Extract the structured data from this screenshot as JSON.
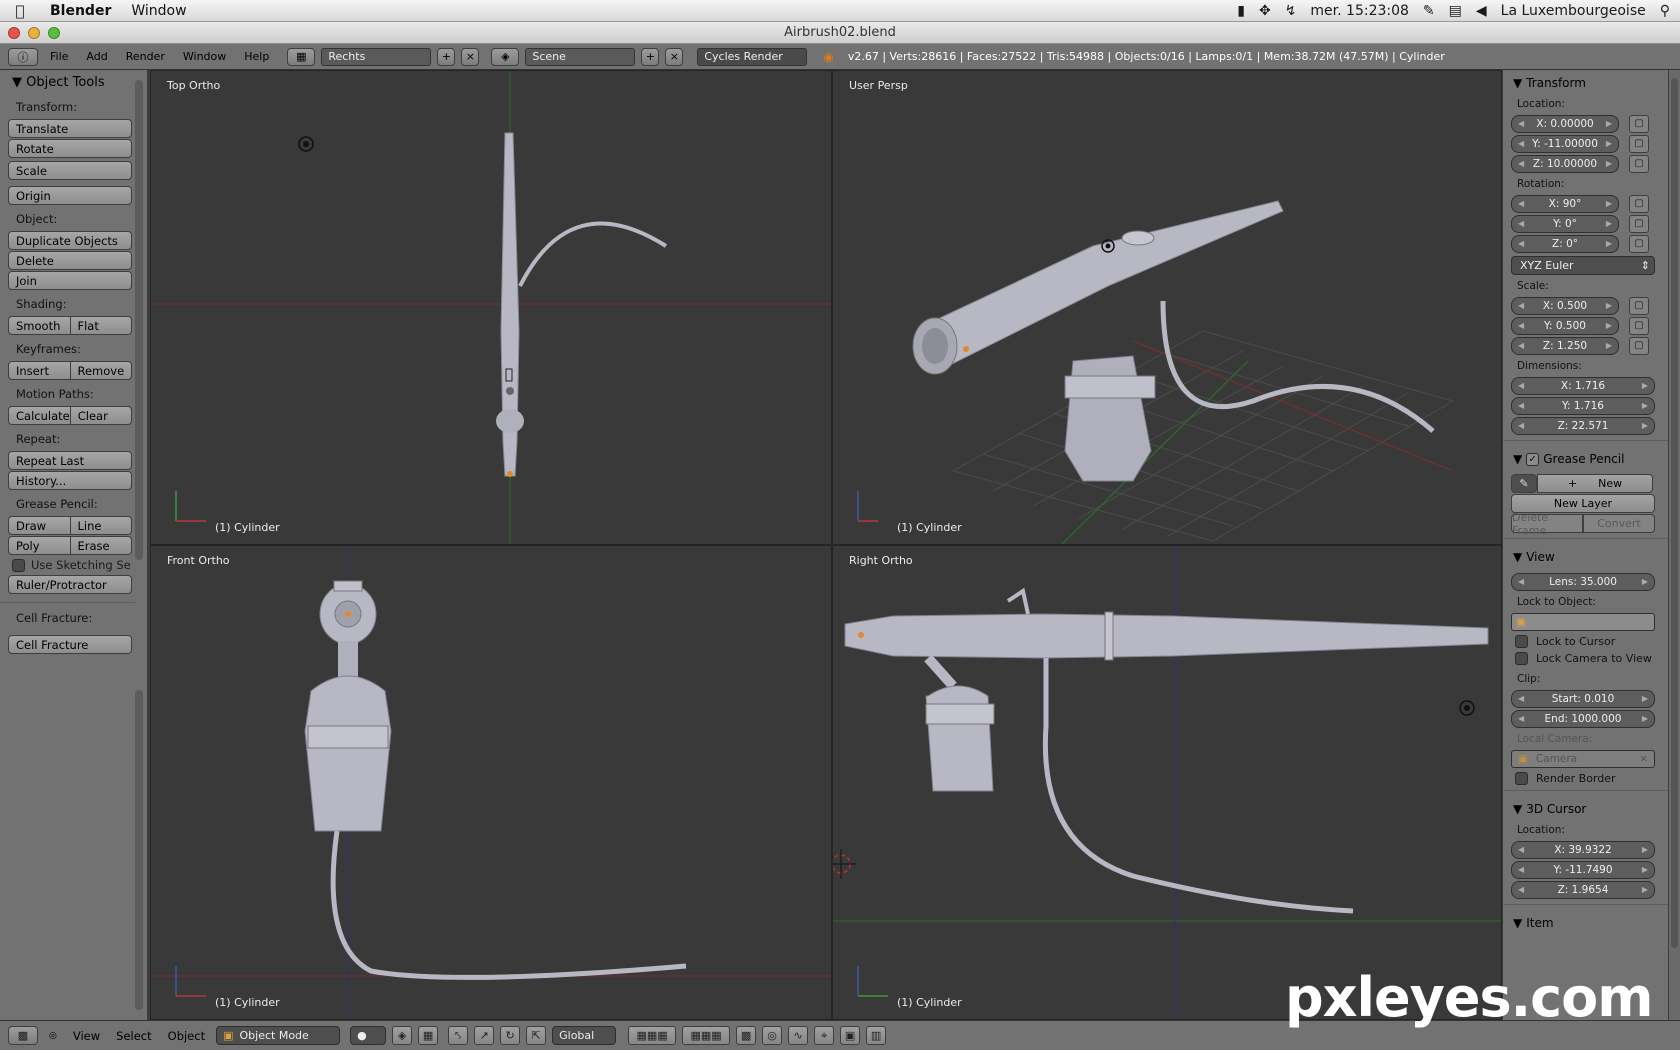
{
  "menubar": {
    "apple": "",
    "app": "Blender",
    "window": "Window",
    "clock": "mer. 15:23:08",
    "user": "La Luxembourgeoise"
  },
  "window": {
    "title": "Airbrush02.blend"
  },
  "info_header": {
    "menus": [
      "File",
      "Add",
      "Render",
      "Window",
      "Help"
    ],
    "screen_layout": "Rechts",
    "scene": "Scene",
    "render_engine": "Cycles Render",
    "stats": "v2.67 | Verts:28616 | Faces:27522 | Tris:54988 | Objects:0/16 | Lamps:0/1 | Mem:38.72M (47.57M) | Cylinder"
  },
  "toolshelf": {
    "title": "Object Tools",
    "transform_label": "Transform:",
    "translate": "Translate",
    "rotate": "Rotate",
    "scale": "Scale",
    "origin": "Origin",
    "object_label": "Object:",
    "duplicate": "Duplicate Objects",
    "delete": "Delete",
    "join": "Join",
    "shading_label": "Shading:",
    "smooth": "Smooth",
    "flat": "Flat",
    "keyframes_label": "Keyframes:",
    "insert": "Insert",
    "remove": "Remove",
    "motion_label": "Motion Paths:",
    "calculate": "Calculate",
    "clear": "Clear",
    "repeat_label": "Repeat:",
    "repeat_last": "Repeat Last",
    "history": "History...",
    "grease_label": "Grease Pencil:",
    "draw": "Draw",
    "line": "Line",
    "poly": "Poly",
    "erase": "Erase",
    "sketching": "Use Sketching Se",
    "ruler": "Ruler/Protractor",
    "cell_label": "Cell Fracture:",
    "cell_fracture": "Cell Fracture"
  },
  "viewports": {
    "top": {
      "label": "Top Ortho",
      "object": "(1) Cylinder"
    },
    "persp": {
      "label": "User Persp",
      "object": "(1) Cylinder"
    },
    "front": {
      "label": "Front Ortho",
      "object": "(1) Cylinder"
    },
    "right": {
      "label": "Right Ortho",
      "object": "(1) Cylinder"
    },
    "axis_y": "y",
    "axis_z": "z"
  },
  "properties": {
    "transform": "Transform",
    "location_label": "Location:",
    "loc_x": "X: 0.00000",
    "loc_y": "Y: -11.00000",
    "loc_z": "Z: 10.00000",
    "rotation_label": "Rotation:",
    "rot_x": "X: 90°",
    "rot_y": "Y: 0°",
    "rot_z": "Z: 0°",
    "rot_mode": "XYZ Euler",
    "scale_label": "Scale:",
    "scale_x": "X: 0.500",
    "scale_y": "Y: 0.500",
    "scale_z": "Z: 1.250",
    "dimensions_label": "Dimensions:",
    "dim_x": "X: 1.716",
    "dim_y": "Y: 1.716",
    "dim_z": "Z: 22.571",
    "grease_pencil": "Grease Pencil",
    "gp_new": "New",
    "gp_new_layer": "New Layer",
    "gp_delete_frame": "Delete Frame",
    "gp_convert": "Convert",
    "view": "View",
    "lens": "Lens: 35.000",
    "lock_object_label": "Lock to Object:",
    "lock_cursor": "Lock to Cursor",
    "lock_camera": "Lock Camera to View",
    "clip_label": "Clip:",
    "clip_start": "Start: 0.010",
    "clip_end": "End: 1000.000",
    "local_camera_label": "Local Camera:",
    "camera": "Camera",
    "render_border": "Render Border",
    "cursor_3d": "3D Cursor",
    "cursor_loc_label": "Location:",
    "cur_x": "X: 39.9322",
    "cur_y": "Y: -11.7490",
    "cur_z": "Z: 1.9654",
    "item": "Item"
  },
  "bottom_header": {
    "view": "View",
    "select": "Select",
    "object": "Object",
    "mode": "Object Mode",
    "orientation": "Global"
  },
  "watermark": "pxleyes.com",
  "colors": {
    "viewport_bg": "#393939",
    "panel_bg": "#727272",
    "x_axis": "#8a2a2a",
    "y_axis": "#2a7a2a",
    "z_axis": "#2a2a9a",
    "model": "#b8b8c4"
  }
}
